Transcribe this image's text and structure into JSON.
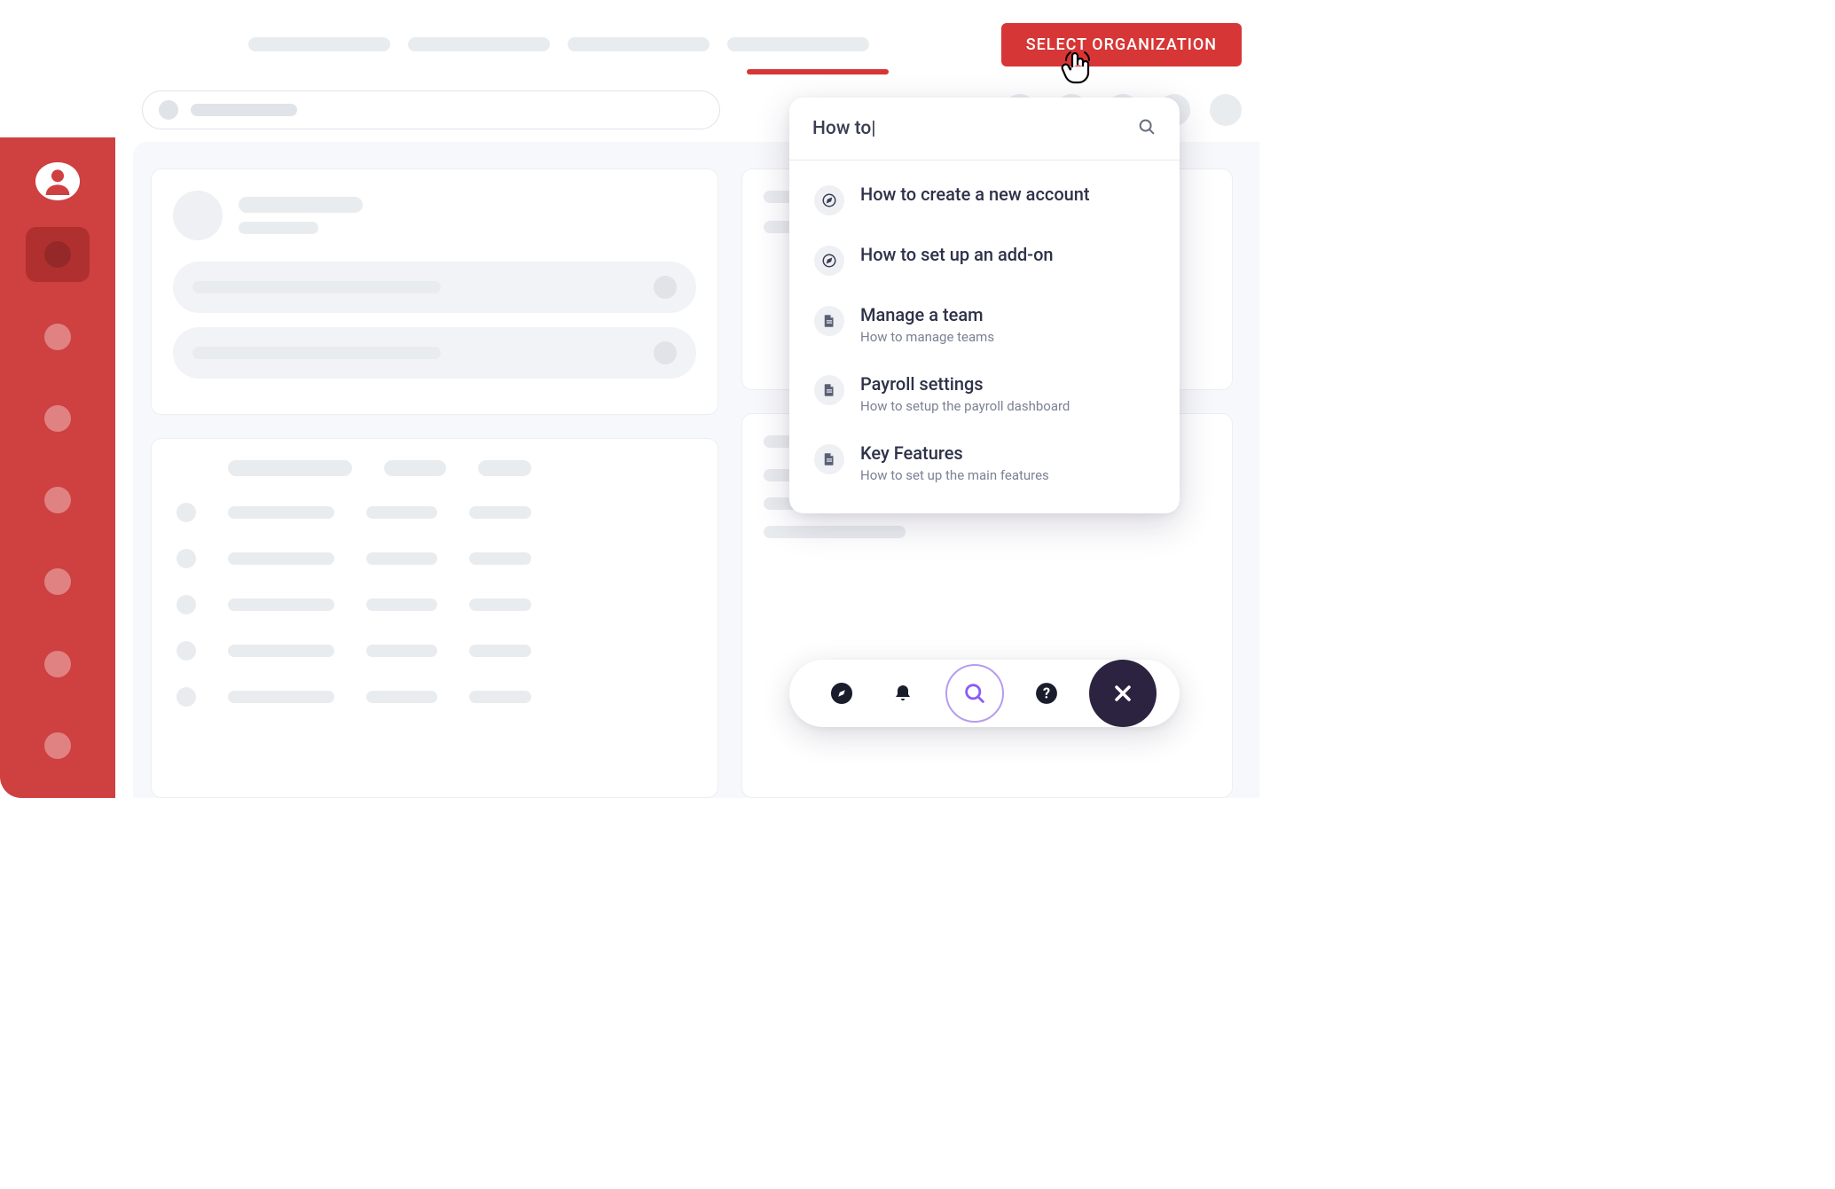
{
  "header": {
    "select_org_label": "SELECT ORGANIZATION"
  },
  "help": {
    "search_value": "How to|",
    "results": [
      {
        "icon": "compass",
        "title": "How to create a new account",
        "subtitle": ""
      },
      {
        "icon": "compass",
        "title": "How to set up an add-on",
        "subtitle": ""
      },
      {
        "icon": "doc",
        "title": "Manage a team",
        "subtitle": "How to manage teams"
      },
      {
        "icon": "doc",
        "title": "Payroll settings",
        "subtitle": "How to setup the payroll dashboard"
      },
      {
        "icon": "doc",
        "title": "Key Features",
        "subtitle": "How to set up the main features"
      }
    ]
  },
  "widget": {
    "buttons": [
      "compass",
      "bell",
      "search",
      "help",
      "close"
    ]
  }
}
